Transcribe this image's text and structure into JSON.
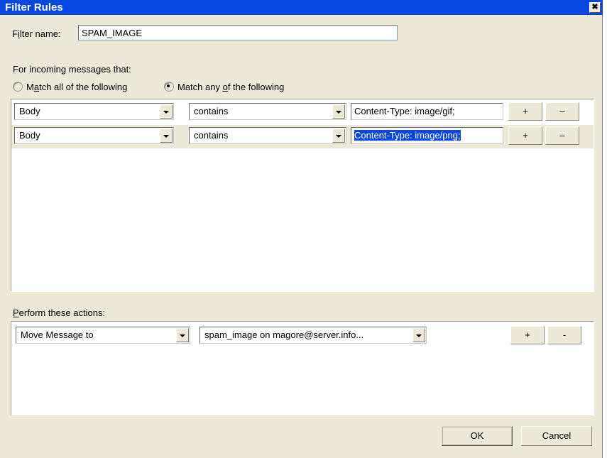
{
  "window": {
    "title": "Filter Rules",
    "close_label": "✖"
  },
  "filter_name": {
    "label_pre": "F",
    "label_acc": "i",
    "label_post": "lter name:",
    "value": "SPAM_IMAGE",
    "placeholder": ""
  },
  "conditions_section": {
    "heading": "For incoming messages that:",
    "match_all": {
      "pre": "M",
      "acc": "a",
      "post": "tch all of the following",
      "selected": false
    },
    "match_any": {
      "pre": "Match any ",
      "acc": "o",
      "post": "f the following",
      "selected": true
    },
    "rows": [
      {
        "field": "Body",
        "operator": "contains",
        "value": "Content-Type: image/gif;",
        "value_selected": false,
        "add_label": "+",
        "remove_label": "–"
      },
      {
        "field": "Body",
        "operator": "contains",
        "value": "Content-Type: image/png;",
        "value_selected": true,
        "add_label": "+",
        "remove_label": "–"
      }
    ]
  },
  "actions_section": {
    "heading_pre": "",
    "heading_acc": "P",
    "heading_post": "erform these actions:",
    "rows": [
      {
        "action": "Move Message to",
        "target": "spam_image on magore@server.info...",
        "add_label": "+",
        "remove_label": "-"
      }
    ]
  },
  "footer": {
    "ok_label": "OK",
    "cancel_label": "Cancel"
  },
  "colors": {
    "titlebar": "#0a46e0",
    "dialog_face": "#ece9d8",
    "selection": "#0a46e0",
    "panel_bg": "#ffffff"
  }
}
